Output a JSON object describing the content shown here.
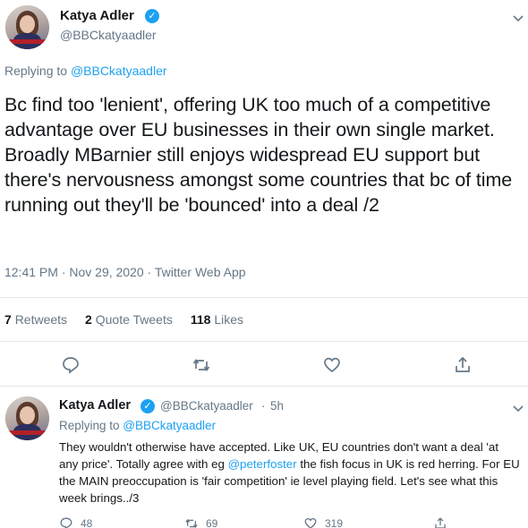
{
  "main_tweet": {
    "author_name": "Katya Adler",
    "author_handle": "@BBCkatyaadler",
    "replying_prefix": "Replying to ",
    "replying_to": "@BBCkatyaadler",
    "text": "Bc find too 'lenient', offering UK too much of a competitive advantage over EU businesses in their own single market. Broadly MBarnier still enjoys widespread EU support but there's nervousness amongst some countries that bc of time running out they'll be 'bounced' into a deal /2",
    "timestamp": "12:41 PM · Nov 29, 2020 · Twitter Web App",
    "retweets_count": "7",
    "retweets_label": "Retweets",
    "quote_count": "2",
    "quote_label": "Quote Tweets",
    "likes_count": "118",
    "likes_label": "Likes"
  },
  "reply_tweet": {
    "author_name": "Katya Adler",
    "author_handle": "@BBCkatyaadler",
    "separator": "·",
    "time": "5h",
    "replying_prefix": "Replying to ",
    "replying_to": "@BBCkatyaadler",
    "text_before_mention": "They wouldn't otherwise have accepted. Like UK, EU countries don't want a deal 'at any price'. Totally agree with eg ",
    "mention": "@peterfoster",
    "text_after_mention": " the fish focus in UK is red herring. For EU the MAIN preoccupation is 'fair competition' ie level playing field. Let's see what this week brings../3",
    "reply_count": "48",
    "retweet_count": "69",
    "like_count": "319"
  },
  "icons": {
    "verified": "verified-badge-icon",
    "menu": "chevron-down-icon",
    "reply": "reply-icon",
    "retweet": "retweet-icon",
    "like": "heart-icon",
    "share": "share-icon"
  },
  "colors": {
    "accent": "#1da1f2",
    "text": "#14171a",
    "secondary": "#657786",
    "divider": "#e1e8ed"
  }
}
